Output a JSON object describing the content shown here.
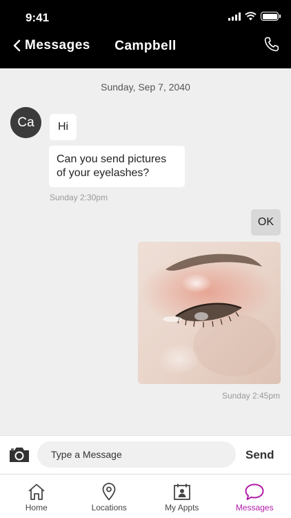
{
  "status_bar": {
    "time": "9:41"
  },
  "header": {
    "back_label": "Messages",
    "title": "Campbell"
  },
  "chat": {
    "date_separator": "Sunday, Sep 7, 2040",
    "contact_initials": "Ca",
    "messages": [
      {
        "direction": "in",
        "text": "Hi"
      },
      {
        "direction": "in",
        "text": "Can you send pictures of your eyelashes?"
      },
      {
        "direction": "out",
        "text": "OK"
      }
    ],
    "timestamps": {
      "incoming": "Sunday 2:30pm",
      "outgoing": "Sunday 2:45pm"
    }
  },
  "composer": {
    "placeholder": "Type a Message",
    "send_label": "Send"
  },
  "tabs": [
    {
      "label": "Home",
      "icon": "home-icon"
    },
    {
      "label": "Locations",
      "icon": "location-pin-icon"
    },
    {
      "label": "My Appts",
      "icon": "calendar-person-icon"
    },
    {
      "label": "Messages",
      "icon": "chat-bubble-icon"
    }
  ],
  "colors": {
    "header_bg": "#000000",
    "active_tab": "#b01aa8",
    "chat_bg": "#efefef",
    "outgoing_bubble": "#d8d8d8"
  }
}
